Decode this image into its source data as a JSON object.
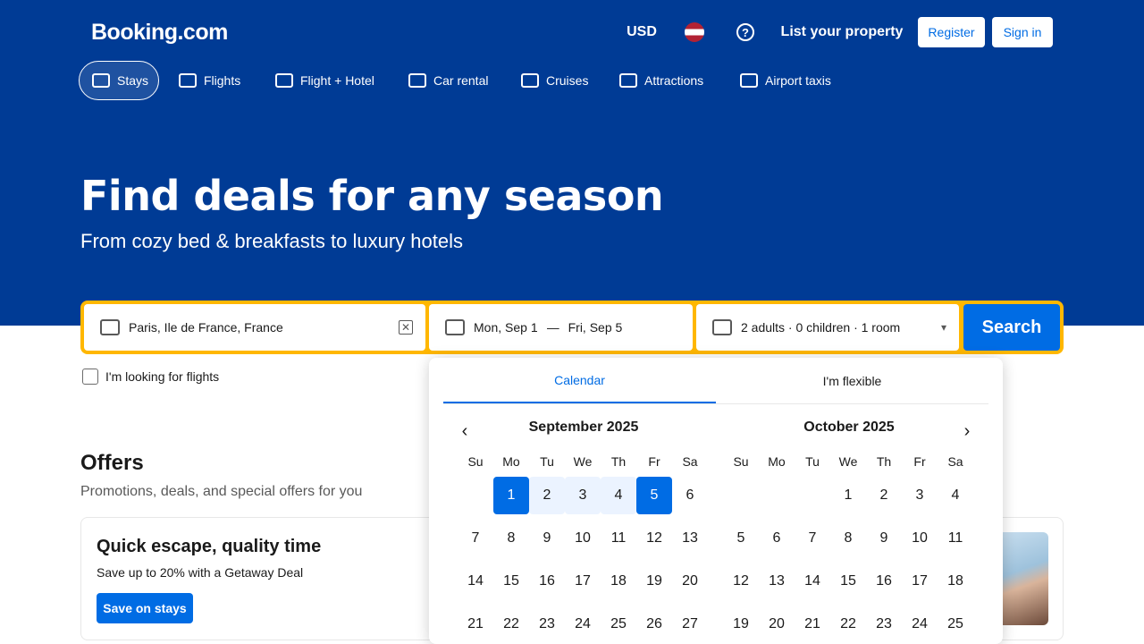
{
  "header": {
    "logo": "Booking.com",
    "currency": "USD",
    "list_property": "List your property",
    "register": "Register",
    "sign_in": "Sign in",
    "help_symbol": "?"
  },
  "nav": {
    "items": [
      {
        "label": "Stays",
        "icon": "bed-icon"
      },
      {
        "label": "Flights",
        "icon": "plane-icon"
      },
      {
        "label": "Flight + Hotel",
        "icon": "flight-hotel-icon"
      },
      {
        "label": "Car rental",
        "icon": "car-icon"
      },
      {
        "label": "Cruises",
        "icon": "ship-icon"
      },
      {
        "label": "Attractions",
        "icon": "attractions-icon"
      },
      {
        "label": "Airport taxis",
        "icon": "taxi-icon"
      }
    ]
  },
  "hero": {
    "title": "Find deals for any season",
    "subtitle": "From cozy bed & breakfasts to luxury hotels"
  },
  "search": {
    "destination": "Paris, Ile de France, France",
    "clear": "✕",
    "checkin": "Mon, Sep 1",
    "separator": "—",
    "checkout": "Fri, Sep 5",
    "occupancy": "2 adults · 0 children · 1 room",
    "button": "Search",
    "flight_checkbox": "I'm looking for flights"
  },
  "calendar": {
    "tabs": [
      "Calendar",
      "I'm flexible"
    ],
    "prev": "‹",
    "next": "›",
    "weekdays": [
      "Su",
      "Mo",
      "Tu",
      "We",
      "Th",
      "Fr",
      "Sa"
    ],
    "months": [
      {
        "title": "September 2025",
        "rows": [
          [
            "",
            "1",
            "2",
            "3",
            "4",
            "5",
            "6"
          ],
          [
            "7",
            "8",
            "9",
            "10",
            "11",
            "12",
            "13"
          ],
          [
            "14",
            "15",
            "16",
            "17",
            "18",
            "19",
            "20"
          ],
          [
            "21",
            "22",
            "23",
            "24",
            "25",
            "26",
            "27"
          ]
        ]
      },
      {
        "title": "October 2025",
        "rows": [
          [
            "",
            "",
            "",
            "1",
            "2",
            "3",
            "4"
          ],
          [
            "5",
            "6",
            "7",
            "8",
            "9",
            "10",
            "11"
          ],
          [
            "12",
            "13",
            "14",
            "15",
            "16",
            "17",
            "18"
          ],
          [
            "19",
            "20",
            "21",
            "22",
            "23",
            "24",
            "25"
          ]
        ]
      }
    ]
  },
  "offers": {
    "title": "Offers",
    "subtitle": "Promotions, deals, and special offers for you",
    "card": {
      "title": "Quick escape, quality time",
      "subtitle": "Save up to 20% with a Getaway Deal",
      "button": "Save on stays"
    }
  },
  "colors": {
    "brand": "#003b95",
    "accent": "#006ce4",
    "search_border": "#ffb700"
  }
}
